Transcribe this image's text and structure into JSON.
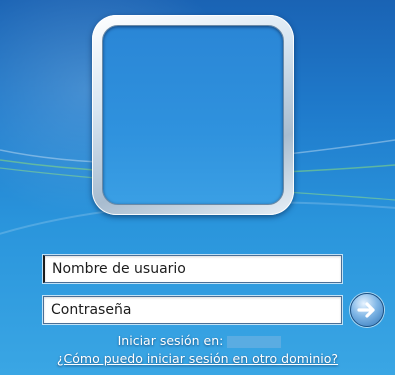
{
  "login": {
    "username_placeholder": "Nombre de usuario",
    "password_placeholder": "Contraseña",
    "signin_prefix": "Iniciar sesión en:",
    "help_link": "¿Cómo puedo iniciar sesión en otro dominio?"
  },
  "icons": {
    "avatar": "user-avatar-frame",
    "submit": "arrow-right-icon"
  },
  "colors": {
    "background": "#1f7bcc",
    "accent": "#2f75b8"
  }
}
